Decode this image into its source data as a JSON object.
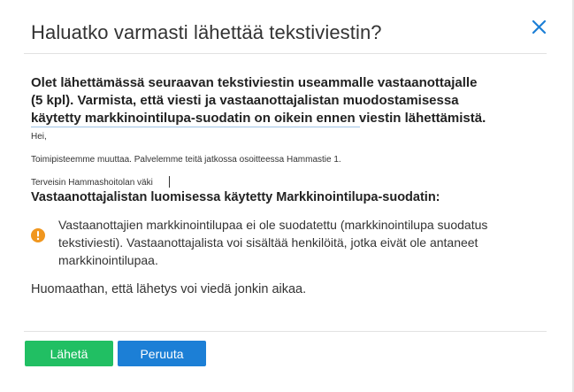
{
  "dialog": {
    "title": "Haluatko varmasti lähettää tekstiviestin?",
    "intro": "Olet lähettämässä seuraavan tekstiviestin useammalle vastaanottajalle (5 kpl). Varmista, että viesti ja vastaanottajalistan muodostamisessa käytetty markkinointilupa-suodatin on oikein ennen viestin lähettämistä.",
    "message_lines": [
      "Hei,",
      "Toimipisteemme muuttaa. Palvelemme teitä jatkossa osoitteessa Hammastie 1.",
      "Terveisin Hammashoitolan väki"
    ],
    "filter_heading": "Vastaanottajalistan luomisessa käytetty Markkinointilupa-suodatin:",
    "warning_text": "Vastaanottajien markkinointilupaa ei ole suodatettu (markkinointilupa suodatus tekstiviesti). Vastaanottajalista voi sisältää henkilöitä, jotka eivät ole antaneet markkinointilupaa.",
    "note": "Huomaathan, että lähetys voi viedä jonkin aikaa.",
    "buttons": {
      "send": "Lähetä",
      "cancel": "Peruuta"
    }
  },
  "colors": {
    "send_button": "#21bf63",
    "cancel_button": "#1c7fd6",
    "close_icon": "#1c7fd6",
    "info_icon": "#f0961e"
  },
  "icons": {
    "close": "close-icon",
    "info": "info-icon"
  }
}
